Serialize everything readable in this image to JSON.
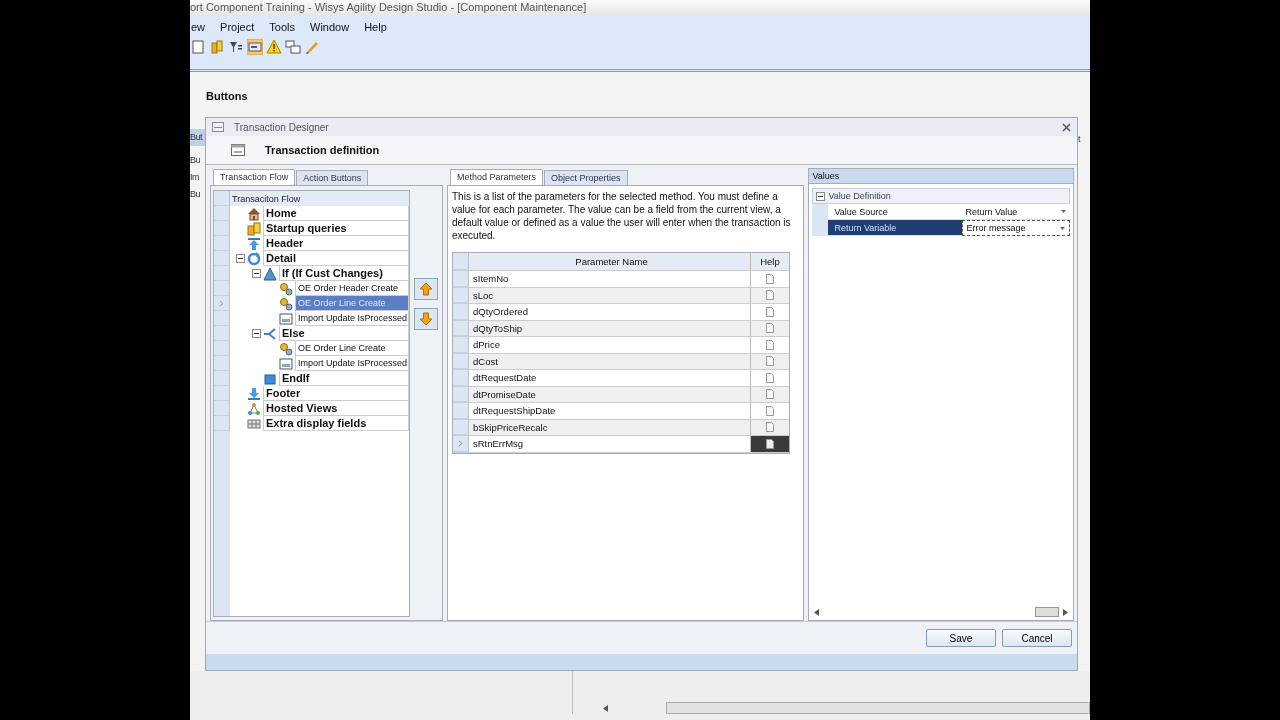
{
  "app_title": "ort Component Training - Wisys Agility Design Studio - [Component Maintenance]",
  "menu": [
    "ew",
    "Project",
    "Tools",
    "Window",
    "Help"
  ],
  "toolbar": [
    {
      "kind": "page",
      "selected": false
    },
    {
      "kind": "cylinders",
      "selected": false
    },
    {
      "kind": "filter",
      "selected": false
    },
    {
      "kind": "textbox",
      "selected": true
    },
    {
      "kind": "warning",
      "selected": false
    },
    {
      "kind": "windows",
      "selected": false
    },
    {
      "kind": "pencil",
      "selected": false
    }
  ],
  "page_heading": "Buttons",
  "background_left": [
    "But",
    "Bu",
    "Im",
    "Bu"
  ],
  "background_right": "t",
  "dialog": {
    "title": "Transaction Designer",
    "header": "Transaction definition",
    "left_tabs": [
      {
        "label": "Transaction Flow",
        "selected": true
      },
      {
        "label": "Action Buttons",
        "selected": false
      }
    ],
    "tree": {
      "heading": "Transaciton Flow",
      "items": [
        {
          "label": "Home",
          "kind": "home",
          "selected": false
        },
        {
          "label": "Startup queries",
          "kind": "query",
          "selected": false
        },
        {
          "label": "Header",
          "kind": "header",
          "selected": false
        },
        {
          "label": "Detail",
          "kind": "detail",
          "selected": false,
          "expanded": true,
          "children": [
            {
              "label": "If  (If Cust Changes)",
              "kind": "if",
              "selected": false,
              "expanded": true,
              "children": [
                {
                  "label": "OE Order Header Create",
                  "kind": "method",
                  "selected": false
                },
                {
                  "label": "OE Order Line Create",
                  "kind": "method",
                  "selected": true
                },
                {
                  "label": "Import Update IsProcessed",
                  "kind": "import",
                  "selected": false
                }
              ]
            },
            {
              "label": "Else",
              "kind": "else",
              "selected": false,
              "expanded": true,
              "children": [
                {
                  "label": "OE Order Line Create",
                  "kind": "method",
                  "selected": false
                },
                {
                  "label": "Import Update IsProcessed",
                  "kind": "import",
                  "selected": false
                }
              ]
            },
            {
              "label": "EndIf",
              "kind": "endif",
              "selected": false
            }
          ]
        },
        {
          "label": "Footer",
          "kind": "footer",
          "selected": false
        },
        {
          "label": "Hosted Views",
          "kind": "views",
          "selected": false
        },
        {
          "label": "Extra display fields",
          "kind": "fields",
          "selected": false
        }
      ]
    },
    "middle_tabs": [
      {
        "label": "Method Parameters",
        "selected": true
      },
      {
        "label": "Object Properties",
        "selected": false
      }
    ],
    "description": "This is a list of the parameters for the selected method.  You must define a value for each parameter.  The value can be a field from the current view, a default value or defined as a value the user will enter when the transaction is executed.",
    "params": {
      "columns": [
        "Parameter Name",
        "Help"
      ],
      "rows": [
        {
          "name": "sItemNo",
          "selected": false
        },
        {
          "name": "sLoc",
          "selected": false
        },
        {
          "name": "dQtyOrdered",
          "selected": false
        },
        {
          "name": "dQtyToShip",
          "selected": false
        },
        {
          "name": "dPrice",
          "selected": false
        },
        {
          "name": "dCost",
          "selected": false
        },
        {
          "name": "dtRequestDate",
          "selected": false
        },
        {
          "name": "dtPromiseDate",
          "selected": false
        },
        {
          "name": "dtRequestShipDate",
          "selected": false
        },
        {
          "name": "bSkipPriceRecalc",
          "selected": false
        },
        {
          "name": "sRtnErrMsg",
          "selected": true
        }
      ]
    },
    "values": {
      "title": "Values",
      "group": {
        "label": "Value Definition",
        "expanded": true,
        "properties": [
          {
            "name": "Value Source",
            "value": "Return Value",
            "selected": false
          },
          {
            "name": "Return Variable",
            "value": "Error message",
            "selected": true
          }
        ]
      }
    },
    "buttons": [
      "Save",
      "Cancel"
    ]
  }
}
